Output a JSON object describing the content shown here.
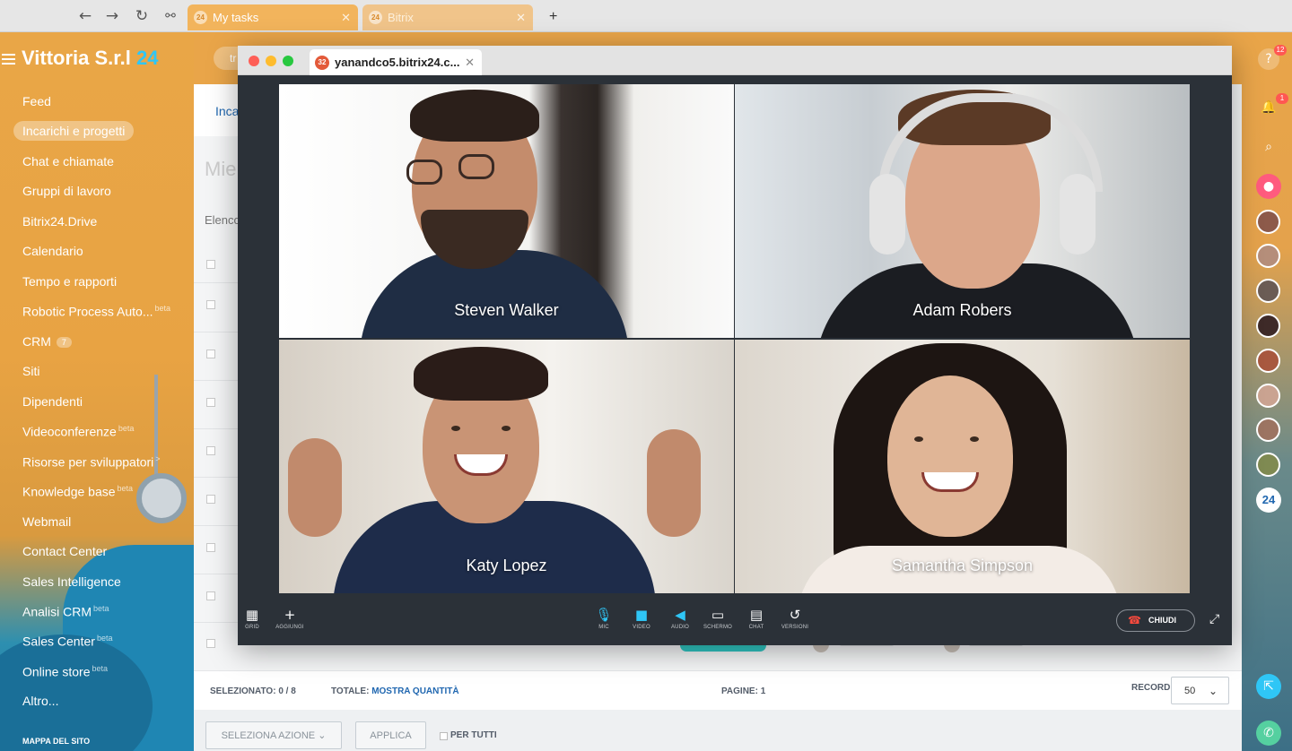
{
  "browser": {
    "tabs": [
      {
        "label": "My tasks",
        "favicon": "24"
      },
      {
        "label": "Bitrix",
        "favicon": "24"
      }
    ],
    "new_tab": "+"
  },
  "sidebar": {
    "company": "Vittoria S.r.l",
    "company_suffix": "24",
    "items": [
      {
        "label": "Feed"
      },
      {
        "label": "Incarichi e progetti"
      },
      {
        "label": "Chat e chiamate"
      },
      {
        "label": "Gruppi di lavoro"
      },
      {
        "label": "Bitrix24.Drive"
      },
      {
        "label": "Calendario"
      },
      {
        "label": "Tempo e rapporti"
      },
      {
        "label": "Robotic Process Auto...",
        "sup": "beta"
      },
      {
        "label": "CRM",
        "count": "7"
      },
      {
        "label": "Siti"
      },
      {
        "label": "Dipendenti"
      },
      {
        "label": "Videoconferenze",
        "sup": "beta"
      },
      {
        "label": "Risorse per sviluppatori",
        "sup": ">"
      },
      {
        "label": "Knowledge base",
        "sup": "beta"
      },
      {
        "label": "Webmail"
      },
      {
        "label": "Contact Center"
      },
      {
        "label": "Sales Intelligence"
      },
      {
        "label": "Analisi CRM",
        "sup": "beta"
      },
      {
        "label": "Sales Center",
        "sup": "beta"
      },
      {
        "label": "Online store",
        "sup": "beta"
      },
      {
        "label": "Altro..."
      }
    ],
    "sitemap": "MAPPA DEL SITO"
  },
  "main": {
    "search_hint": "tr",
    "tab_label": "Inca",
    "page_title_partial": "Mie",
    "list_label_partial": "Elenco"
  },
  "footer": {
    "selected_label": "SELEZIONATO:",
    "selected_value": "0 / 8",
    "total_label": "TOTALE:",
    "total_link": "MOSTRA QUANTITÀ",
    "pages_label": "PAGINE:",
    "pages_value": "1",
    "record_label": "RECORD:",
    "record_value": "50",
    "select_action": "SELEZIONA AZIONE",
    "apply": "APPLICA",
    "for_all": "PER TUTTI"
  },
  "rail": {
    "help_badge": "12",
    "bell_badge": "1",
    "logo": "24"
  },
  "video_call": {
    "window_tab_title": "yanandco5.bitrix24.c...",
    "window_tab_favicon": "32",
    "participants": [
      {
        "name": "Steven Walker"
      },
      {
        "name": "Adam Robers"
      },
      {
        "name": "Katy Lopez"
      },
      {
        "name": "Samantha Simpson"
      }
    ],
    "controls": {
      "grid": "GRID",
      "add": "AGGIUNGI",
      "mic": "MIC",
      "video": "VIDEO",
      "audio": "AUDIO",
      "screen": "SCHERMO",
      "chat": "CHAT",
      "versions": "VERSIONI",
      "hangup": "CHIUDI"
    },
    "colors": {
      "accent": "#2fc6f6",
      "hangup": "#ff4a3d",
      "toolbar": "#2b3138"
    }
  },
  "icons": {
    "back": "arrow-left-icon",
    "forward": "arrow-right-icon",
    "reload": "reload-icon",
    "link": "link-icon"
  }
}
